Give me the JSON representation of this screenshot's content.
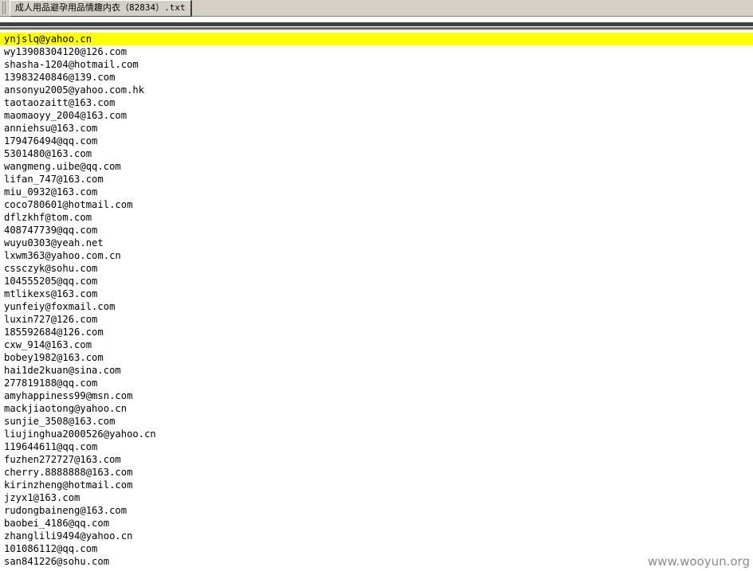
{
  "tab": {
    "filename": "成人用品避孕用品情趣内衣（82834）.txt"
  },
  "editor": {
    "current_line_color": "#ffff00",
    "lines": [
      "ynjslq@yahoo.cn",
      "wy13908304120@126.com",
      "shasha-1204@hotmail.com",
      "13983240846@139.com",
      "ansonyu2005@yahoo.com.hk",
      "taotaozaitt@163.com",
      "maomaoyy_2004@163.com",
      "anniehsu@163.com",
      "179476494@qq.com",
      "5301480@163.com",
      "wangmeng.uibe@qq.com",
      "lifan_747@163.com",
      "miu_0932@163.com",
      "coco780601@hotmail.com",
      "dflzkhf@tom.com",
      "408747739@qq.com",
      "wuyu0303@yeah.net",
      "lxwm363@yahoo.com.cn",
      "cssczyk@sohu.com",
      "104555205@qq.com",
      "mtlikexs@163.com",
      "yunfeiy@foxmail.com",
      "luxin727@126.com",
      "185592684@126.com",
      "cxw_914@163.com",
      "bobey1982@163.com",
      "hai1de2kuan@sina.com",
      "277819188@qq.com",
      "amyhappiness99@msn.com",
      "mackjiaotong@yahoo.cn",
      "sunjie_3508@163.com",
      "liujinghua2000526@yahoo.cn",
      "119644611@qq.com",
      "fuzhen272727@163.com",
      "cherry.8888888@163.com",
      "kirinzheng@hotmail.com",
      "jzyx1@163.com",
      "rudongbaineng@163.com",
      "baobei_4186@qq.com",
      "zhanglili9494@yahoo.cn",
      "101086112@qq.com",
      "san841226@sohu.com"
    ]
  },
  "watermark": {
    "text": "www.wooyun.org"
  }
}
